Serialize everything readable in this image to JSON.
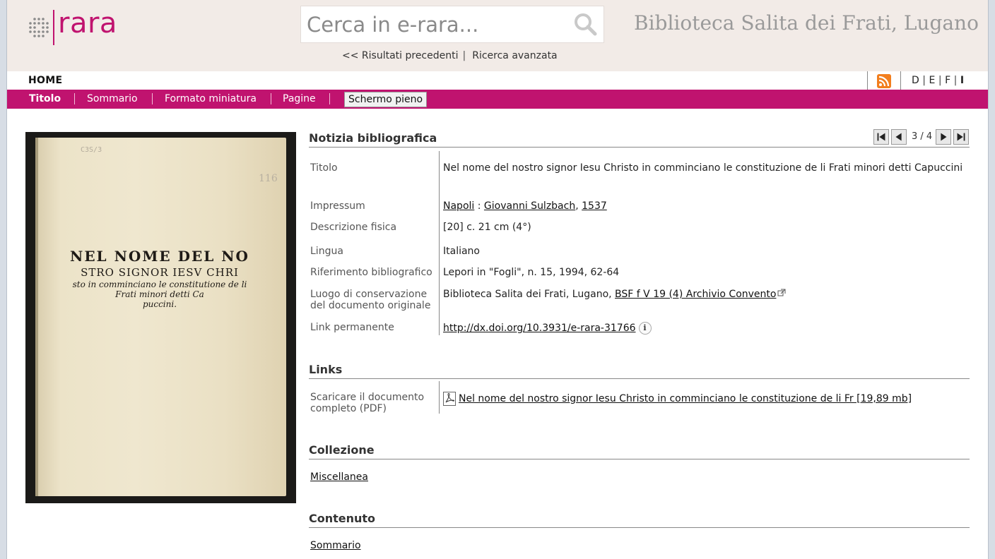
{
  "header": {
    "logo_text": "rara",
    "search_placeholder": "Cerca in e-rara...",
    "library_title": "Biblioteca Salita dei Frati, Lugano",
    "prev_results": "<< Risultati precedenti",
    "advanced_search": "Ricerca avanzata"
  },
  "nav": {
    "home": "HOME",
    "languages": [
      "D",
      "E",
      "F",
      "I"
    ],
    "active_language": "I"
  },
  "tabs": [
    {
      "label": "Titolo",
      "active": true
    },
    {
      "label": "Sommario",
      "active": false
    },
    {
      "label": "Formato miniatura",
      "active": false
    },
    {
      "label": "Pagine",
      "active": false
    }
  ],
  "fullscreen_button": "Schermo pieno",
  "book_image": {
    "line1": "NEL NOME DEL NO",
    "line2": "STRO SIGNOR IESV CHRI",
    "line3": "sto in comminciano le constitutione de li",
    "line4": "Frati minori detti Ca",
    "line5": "puccini.",
    "shelf_mark": "C3S/3",
    "corner_mark": "116"
  },
  "bibliographic": {
    "heading": "Notizia bibliografica",
    "pager": "3 / 4",
    "rows": {
      "titolo_label": "Titolo",
      "titolo_value": "Nel nome del nostro signor Iesu Christo in comminciano le constituzione de li Frati minori detti Capuccini",
      "impressum_label": "Impressum",
      "impressum_place": "Napoli",
      "impressum_sep": " : ",
      "impressum_printer": "Giovanni Sulzbach",
      "impressum_comma": ", ",
      "impressum_year": "1537",
      "descrizione_label": "Descrizione fisica",
      "descrizione_value": "[20] c. 21 cm (4°)",
      "lingua_label": "Lingua",
      "lingua_value": "Italiano",
      "riferimento_label": "Riferimento bibliografico",
      "riferimento_value": "Lepori in \"Fogli\", n. 15, 1994, 62-64",
      "luogo_label": "Luogo di conservazione del documento originale",
      "luogo_value": "Biblioteca Salita dei Frati, Lugano, ",
      "luogo_link": "BSF f V 19 (4) Archivio Convento",
      "link_label": "Link permanente",
      "link_value": "http://dx.doi.org/10.3931/e-rara-31766",
      "info_glyph": "i"
    }
  },
  "links": {
    "heading": "Links",
    "download_label": "Scaricare il documento completo (PDF)",
    "download_link": "Nel nome del nostro signor Iesu Christo in comminciano le constituzione de li Fr [19,89 mb]"
  },
  "collection": {
    "heading": "Collezione",
    "item": "Miscellanea"
  },
  "contents": {
    "heading": "Contenuto",
    "item": "Sommario"
  },
  "colors": {
    "brand": "#c0136f",
    "header_bg": "#f2ebe7",
    "rss": "#f27e1e"
  }
}
